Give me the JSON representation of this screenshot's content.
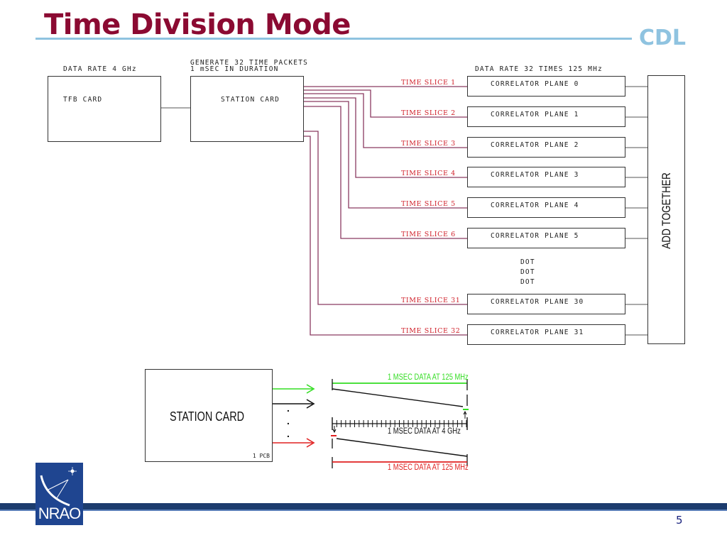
{
  "slide": {
    "title": "Time Division Mode",
    "brand": "CDL",
    "page_number": "5",
    "logo_text": "NRAO"
  },
  "colors": {
    "title": "#8b0a32",
    "accent_light_blue": "#8fc3e0",
    "time_slice_label": "#d0202a",
    "wire": "#8a3a60",
    "green_data": "#33dd22",
    "red_data": "#e02020",
    "footer_navy": "#1c3c6e",
    "logo_blue": "#1f4590"
  },
  "top_diagram": {
    "tfb_label_above": "DATA RATE 4 GHz",
    "tfb_card": "TFB CARD",
    "station_label_above_line1": "GENERATE 32 TIME PACKETS",
    "station_label_above_line2": "1 mSEC IN DURATION",
    "station_card": "STATION CARD",
    "correlator_label_above": "DATA RATE 32 TIMES 125 MHz",
    "add_together": "ADD TOGETHER",
    "dots": [
      "DOT",
      "DOT",
      "DOT"
    ],
    "slices": [
      {
        "slice": "TIME SLICE 1",
        "plane": "CORRELATOR PLANE 0"
      },
      {
        "slice": "TIME SLICE 2",
        "plane": "CORRELATOR PLANE 1"
      },
      {
        "slice": "TIME SLICE 3",
        "plane": "CORRELATOR PLANE 2"
      },
      {
        "slice": "TIME SLICE 4",
        "plane": "CORRELATOR PLANE 3"
      },
      {
        "slice": "TIME SLICE 5",
        "plane": "CORRELATOR PLANE 4"
      },
      {
        "slice": "TIME SLICE 6",
        "plane": "CORRELATOR PLANE 5"
      },
      {
        "slice": "TIME SLICE 31",
        "plane": "CORRELATOR PLANE 30"
      },
      {
        "slice": "TIME SLICE 32",
        "plane": "CORRELATOR PLANE 31"
      }
    ]
  },
  "bottom_diagram": {
    "station_card": "STATION CARD",
    "pcb_label": "1 PCB",
    "green_label": "1 MSEC DATA AT 125 MHz",
    "middle_label": "1 MSEC DATA AT 4 GHz",
    "red_label": "1 MSEC DATA AT 125 MHz",
    "ellipsis_dots": [
      ".",
      ".",
      "."
    ]
  }
}
